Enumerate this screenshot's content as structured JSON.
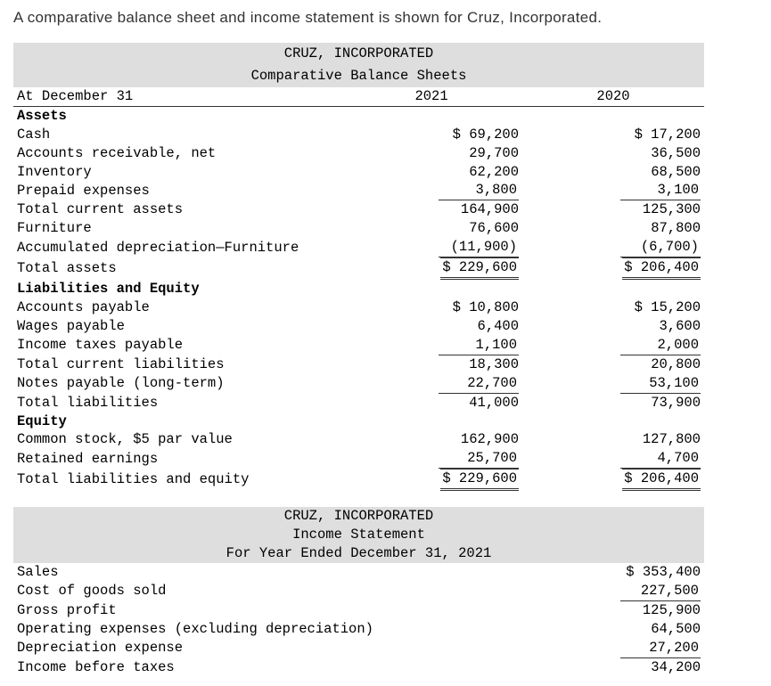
{
  "intro": "A comparative balance sheet and income statement is shown for Cruz, Incorporated.",
  "bs": {
    "title1": "CRUZ, INCORPORATED",
    "title2": "Comparative Balance Sheets",
    "colhdr": {
      "label": "At December 31",
      "y1": "2021",
      "y2": "2020"
    },
    "sec_assets": "Assets",
    "rows_assets": [
      {
        "label": "Cash",
        "v1": "$ 69,200",
        "v2": "$ 17,200"
      },
      {
        "label": "Accounts receivable, net",
        "v1": "29,700",
        "v2": "36,500"
      },
      {
        "label": "Inventory",
        "v1": "62,200",
        "v2": "68,500"
      },
      {
        "label": "Prepaid expenses",
        "v1": "3,800",
        "v2": "3,100",
        "u": true
      },
      {
        "label": "Total current assets",
        "v1": "164,900",
        "v2": "125,300"
      },
      {
        "label": "Furniture",
        "v1": "76,600",
        "v2": "87,800"
      },
      {
        "label": "Accumulated depreciation—Furniture",
        "v1": "(11,900)",
        "v2": "(6,700)",
        "u": true
      },
      {
        "label": "Total assets",
        "v1": "$ 229,600",
        "v2": "$ 206,400",
        "dbl": true
      }
    ],
    "sec_liab": "Liabilities and Equity",
    "rows_liab": [
      {
        "label": "Accounts payable",
        "v1": "$ 10,800",
        "v2": "$ 15,200"
      },
      {
        "label": "Wages payable",
        "v1": "6,400",
        "v2": "3,600"
      },
      {
        "label": "Income taxes payable",
        "v1": "1,100",
        "v2": "2,000",
        "u": true
      },
      {
        "label": "Total current liabilities",
        "v1": "18,300",
        "v2": "20,800"
      },
      {
        "label": "Notes payable (long-term)",
        "v1": "22,700",
        "v2": "53,100",
        "u": true
      },
      {
        "label": "Total liabilities",
        "v1": "41,000",
        "v2": "73,900"
      }
    ],
    "sec_eq": "Equity",
    "rows_eq": [
      {
        "label": "Common stock, $5 par value",
        "v1": "162,900",
        "v2": "127,800"
      },
      {
        "label": "Retained earnings",
        "v1": "25,700",
        "v2": "4,700",
        "u": true
      },
      {
        "label": "Total liabilities and equity",
        "v1": "$ 229,600",
        "v2": "$ 206,400",
        "dbl": true
      }
    ]
  },
  "is": {
    "title1": "CRUZ, INCORPORATED",
    "title2": "Income Statement",
    "title3": "For Year Ended December 31, 2021",
    "rows": [
      {
        "label": "Sales",
        "v": "$ 353,400"
      },
      {
        "label": "Cost of goods sold",
        "v": "227,500",
        "u": true
      },
      {
        "label": "Gross profit",
        "v": "125,900"
      },
      {
        "label": "Operating expenses (excluding depreciation)",
        "v": "64,500"
      },
      {
        "label": "Depreciation expense",
        "v": "27,200",
        "u": true
      },
      {
        "label": "Income before taxes",
        "v": "34,200"
      }
    ]
  }
}
